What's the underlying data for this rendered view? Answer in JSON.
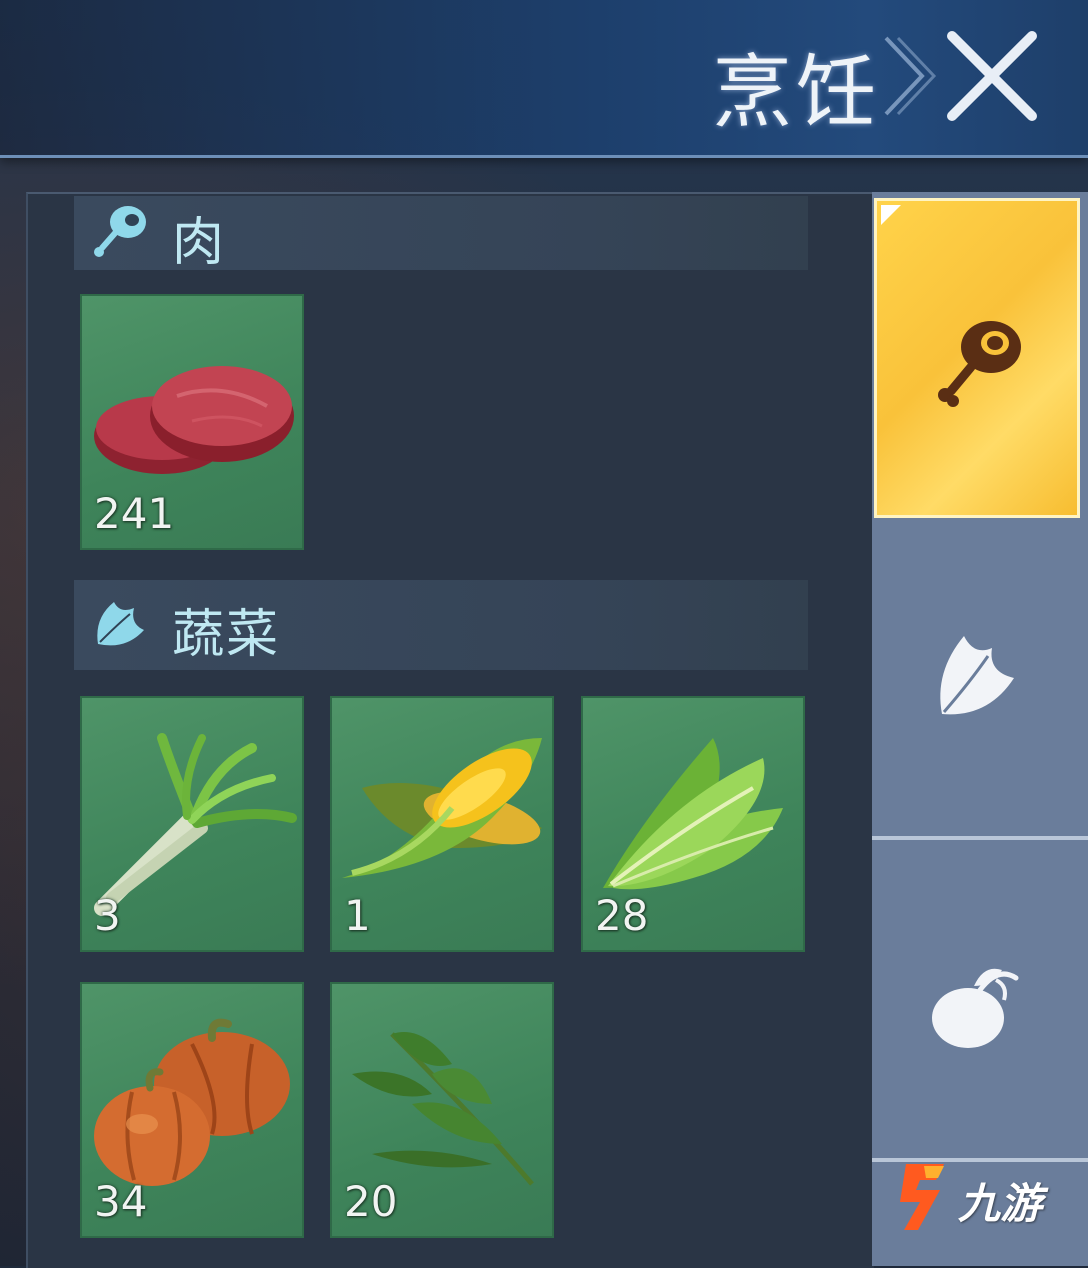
{
  "header": {
    "title": "烹饪",
    "close_icon": "close-x-icon"
  },
  "sections": [
    {
      "label": "肉",
      "icon": "meat-leg-icon",
      "items": [
        {
          "name": "raw-meat",
          "count": "241"
        }
      ]
    },
    {
      "label": "蔬菜",
      "icon": "leaf-vegetable-icon",
      "items": [
        {
          "name": "scallion",
          "count": "3"
        },
        {
          "name": "corn",
          "count": "1"
        },
        {
          "name": "lettuce",
          "count": "28"
        },
        {
          "name": "pumpkin",
          "count": "34"
        },
        {
          "name": "herb",
          "count": "20"
        }
      ]
    }
  ],
  "side_tabs": [
    {
      "icon": "meat-leg-icon",
      "active": true
    },
    {
      "icon": "leaf-vegetable-icon",
      "active": false
    },
    {
      "icon": "fruit-icon",
      "active": false
    }
  ],
  "watermark": {
    "text": "九游",
    "icon": "nine-game-logo-icon"
  },
  "colors": {
    "active_tab": "#f9c23a",
    "item_card": "#3e845a",
    "section_label": "#bfe8f2",
    "side_tabs": "#6a7d9b"
  }
}
